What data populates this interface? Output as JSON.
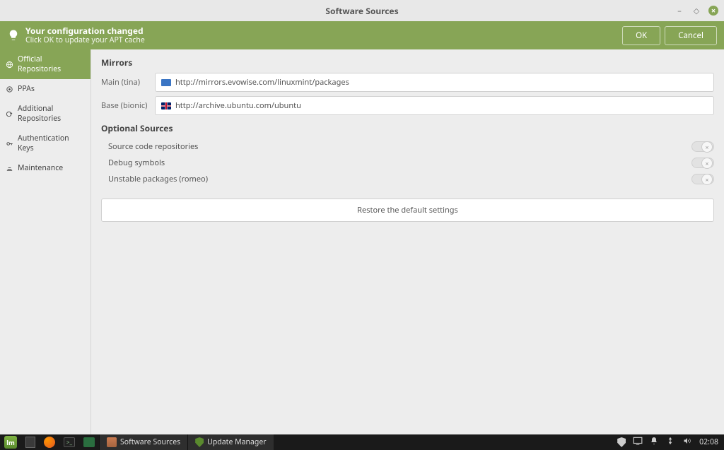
{
  "window": {
    "title": "Software Sources"
  },
  "notify": {
    "line1": "Your configuration changed",
    "line2": "Click OK to update your APT cache",
    "ok": "OK",
    "cancel": "Cancel"
  },
  "sidebar": {
    "items": [
      {
        "label": "Official Repositories"
      },
      {
        "label": "PPAs"
      },
      {
        "label": "Additional Repositories"
      },
      {
        "label": "Authentication Keys"
      },
      {
        "label": "Maintenance"
      }
    ]
  },
  "mirrors": {
    "title": "Mirrors",
    "main_label": "Main (tina)",
    "main_url": "http://mirrors.evowise.com/linuxmint/packages",
    "base_label": "Base (bionic)",
    "base_url": "http://archive.ubuntu.com/ubuntu"
  },
  "optional": {
    "title": "Optional Sources",
    "source_code": "Source code repositories",
    "debug": "Debug symbols",
    "unstable": "Unstable packages (romeo)"
  },
  "restore": "Restore the default settings",
  "taskbar": {
    "task1": "Software Sources",
    "task2": "Update Manager",
    "clock": "02:08"
  }
}
